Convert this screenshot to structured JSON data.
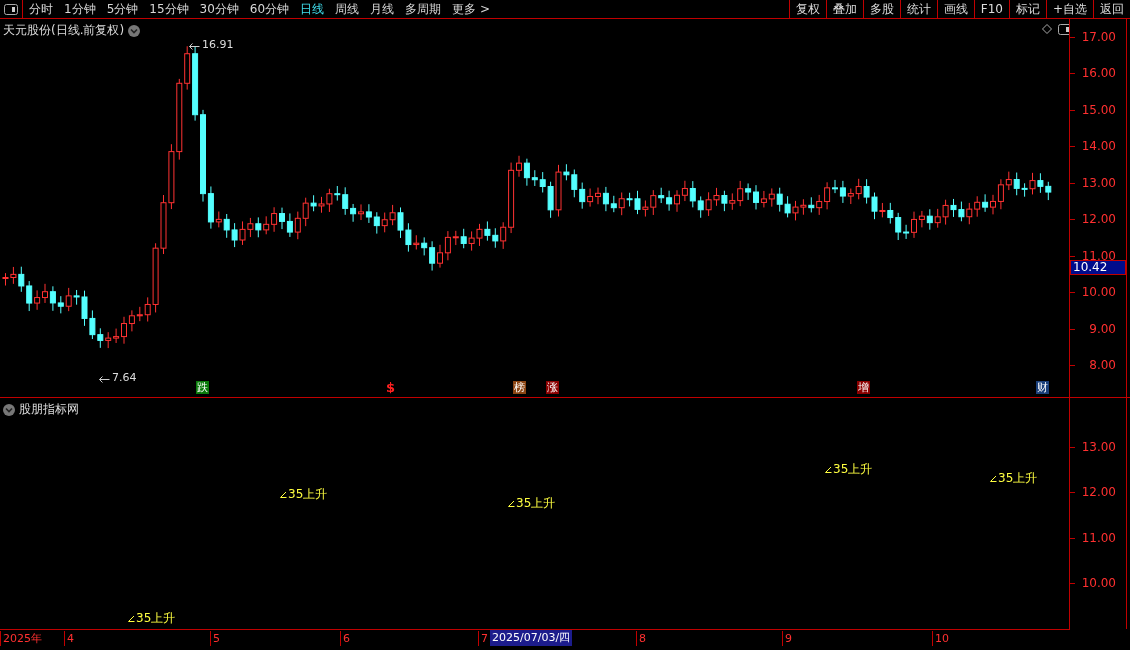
{
  "toolbar": {
    "periods": [
      {
        "label": "分时",
        "selected": false
      },
      {
        "label": "1分钟",
        "selected": false
      },
      {
        "label": "5分钟",
        "selected": false
      },
      {
        "label": "15分钟",
        "selected": false
      },
      {
        "label": "30分钟",
        "selected": false
      },
      {
        "label": "60分钟",
        "selected": false
      },
      {
        "label": "日线",
        "selected": true
      },
      {
        "label": "周线",
        "selected": false
      },
      {
        "label": "月线",
        "selected": false
      },
      {
        "label": "多周期",
        "selected": false
      },
      {
        "label": "更多 >",
        "selected": false
      }
    ],
    "actions": [
      "复权",
      "叠加",
      "多股",
      "统计",
      "画线",
      "F10",
      "标记",
      "+自选",
      "返回"
    ]
  },
  "main_chart": {
    "title": "天元股份(日线.前复权)",
    "high_label": "16.91",
    "low_label": "7.64",
    "markers": [
      {
        "label": "跌",
        "kind": "badge",
        "color": "#0a7a0a"
      },
      {
        "label": "$",
        "kind": "symbol",
        "color": "#ff2020"
      },
      {
        "label": "榜",
        "kind": "badge",
        "color": "#8b4513"
      },
      {
        "label": "涨",
        "kind": "badge",
        "color": "#8b0000"
      },
      {
        "label": "增",
        "kind": "badge",
        "color": "#8b0000"
      },
      {
        "label": "财",
        "kind": "badge",
        "color": "#1a3f7a"
      }
    ],
    "y_ticks": [
      "17.00",
      "16.00",
      "15.00",
      "14.00",
      "13.00",
      "12.00",
      "11.00",
      "10.00",
      "9.00",
      "8.00"
    ],
    "current_price": "10.42"
  },
  "indicator_chart": {
    "title": "股朋指标网",
    "y_ticks": [
      "13.00",
      "12.00",
      "11.00",
      "10.00"
    ],
    "signals": [
      "35上升",
      "35上升",
      "35上升",
      "35上升",
      "35上升"
    ]
  },
  "date_axis": {
    "labels": [
      "2025年",
      "4",
      "5",
      "6",
      "7",
      "8",
      "9",
      "10"
    ],
    "cursor_date": "2025/07/03/四"
  }
}
